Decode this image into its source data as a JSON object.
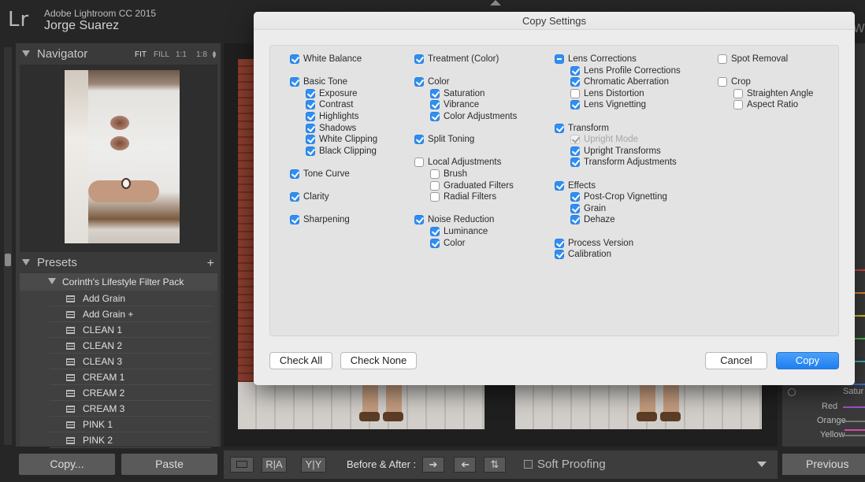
{
  "identity": {
    "logo": "Lr",
    "app_name": "Adobe Lightroom CC 2015",
    "user_name": "Jorge Suarez"
  },
  "navigator": {
    "title": "Navigator",
    "zoom": [
      "FIT",
      "FILL",
      "1:1",
      "1:8"
    ]
  },
  "presets": {
    "title": "Presets",
    "pack": "Corinth's Lifestyle Filter Pack",
    "items": [
      "Add Grain",
      "Add Grain +",
      "CLEAN 1",
      "CLEAN 2",
      "CLEAN 3",
      "CREAM 1",
      "CREAM 2",
      "CREAM 3",
      "PINK 1",
      "PINK 2"
    ]
  },
  "bottom_buttons": {
    "copy": "Copy...",
    "paste": "Paste",
    "previous": "Previous"
  },
  "toolbar": {
    "ra": "R|A",
    "yy": "Y|Y",
    "before_after": "Before & After :",
    "soft_proofing": "Soft Proofing"
  },
  "right_panel": {
    "saturation": "Satur",
    "hsl": [
      "Red",
      "Orange",
      "Yellow"
    ],
    "peek": "ow",
    "hsl_colors": [
      "#d94141",
      "#e08a2e",
      "#d9c62b",
      "#4bbd4a",
      "#3fb2b6",
      "#3e6fd8",
      "#9b4fd0",
      "#d24aa7"
    ]
  },
  "dialog": {
    "title": "Copy Settings",
    "columns": [
      [
        {
          "label": "White Balance",
          "state": "checked",
          "indent": 0
        },
        {
          "gap": true
        },
        {
          "label": "Basic Tone",
          "state": "checked",
          "indent": 0
        },
        {
          "label": "Exposure",
          "state": "checked",
          "indent": 1
        },
        {
          "label": "Contrast",
          "state": "checked",
          "indent": 1
        },
        {
          "label": "Highlights",
          "state": "checked",
          "indent": 1
        },
        {
          "label": "Shadows",
          "state": "checked",
          "indent": 1
        },
        {
          "label": "White Clipping",
          "state": "checked",
          "indent": 1
        },
        {
          "label": "Black Clipping",
          "state": "checked",
          "indent": 1
        },
        {
          "gap": true
        },
        {
          "label": "Tone Curve",
          "state": "checked",
          "indent": 0
        },
        {
          "gap": true
        },
        {
          "label": "Clarity",
          "state": "checked",
          "indent": 0
        },
        {
          "gap": true
        },
        {
          "label": "Sharpening",
          "state": "checked",
          "indent": 0
        }
      ],
      [
        {
          "label": "Treatment (Color)",
          "state": "checked",
          "indent": 0
        },
        {
          "gap": true
        },
        {
          "label": "Color",
          "state": "checked",
          "indent": 0
        },
        {
          "label": "Saturation",
          "state": "checked",
          "indent": 1
        },
        {
          "label": "Vibrance",
          "state": "checked",
          "indent": 1
        },
        {
          "label": "Color Adjustments",
          "state": "checked",
          "indent": 1
        },
        {
          "gap": true
        },
        {
          "label": "Split Toning",
          "state": "checked",
          "indent": 0
        },
        {
          "gap": true
        },
        {
          "label": "Local Adjustments",
          "state": "unchecked",
          "indent": 0
        },
        {
          "label": "Brush",
          "state": "unchecked",
          "indent": 1
        },
        {
          "label": "Graduated Filters",
          "state": "unchecked",
          "indent": 1
        },
        {
          "label": "Radial Filters",
          "state": "unchecked",
          "indent": 1
        },
        {
          "gap": true
        },
        {
          "label": "Noise Reduction",
          "state": "checked",
          "indent": 0
        },
        {
          "label": "Luminance",
          "state": "checked",
          "indent": 1
        },
        {
          "label": "Color",
          "state": "checked",
          "indent": 1
        }
      ],
      [
        {
          "label": "Lens Corrections",
          "state": "mixed",
          "indent": 0
        },
        {
          "label": "Lens Profile Corrections",
          "state": "checked",
          "indent": 1
        },
        {
          "label": "Chromatic Aberration",
          "state": "checked",
          "indent": 1
        },
        {
          "label": "Lens Distortion",
          "state": "unchecked",
          "indent": 1
        },
        {
          "label": "Lens Vignetting",
          "state": "checked",
          "indent": 1
        },
        {
          "gap": true
        },
        {
          "label": "Transform",
          "state": "checked",
          "indent": 0
        },
        {
          "label": "Upright Mode",
          "state": "disabled",
          "indent": 1
        },
        {
          "label": "Upright Transforms",
          "state": "checked",
          "indent": 1
        },
        {
          "label": "Transform Adjustments",
          "state": "checked",
          "indent": 1
        },
        {
          "gap": true
        },
        {
          "label": "Effects",
          "state": "checked",
          "indent": 0
        },
        {
          "label": "Post-Crop Vignetting",
          "state": "checked",
          "indent": 1
        },
        {
          "label": "Grain",
          "state": "checked",
          "indent": 1
        },
        {
          "label": "Dehaze",
          "state": "checked",
          "indent": 1
        },
        {
          "gap": true
        },
        {
          "label": "Process Version",
          "state": "checked",
          "indent": 0
        },
        {
          "label": "Calibration",
          "state": "checked",
          "indent": 0
        }
      ],
      [
        {
          "label": "Spot Removal",
          "state": "unchecked",
          "indent": 0
        },
        {
          "gap": true
        },
        {
          "label": "Crop",
          "state": "unchecked",
          "indent": 0
        },
        {
          "label": "Straighten Angle",
          "state": "unchecked",
          "indent": 1
        },
        {
          "label": "Aspect Ratio",
          "state": "unchecked",
          "indent": 1
        }
      ]
    ],
    "buttons": {
      "check_all": "Check All",
      "check_none": "Check None",
      "cancel": "Cancel",
      "copy": "Copy"
    }
  }
}
